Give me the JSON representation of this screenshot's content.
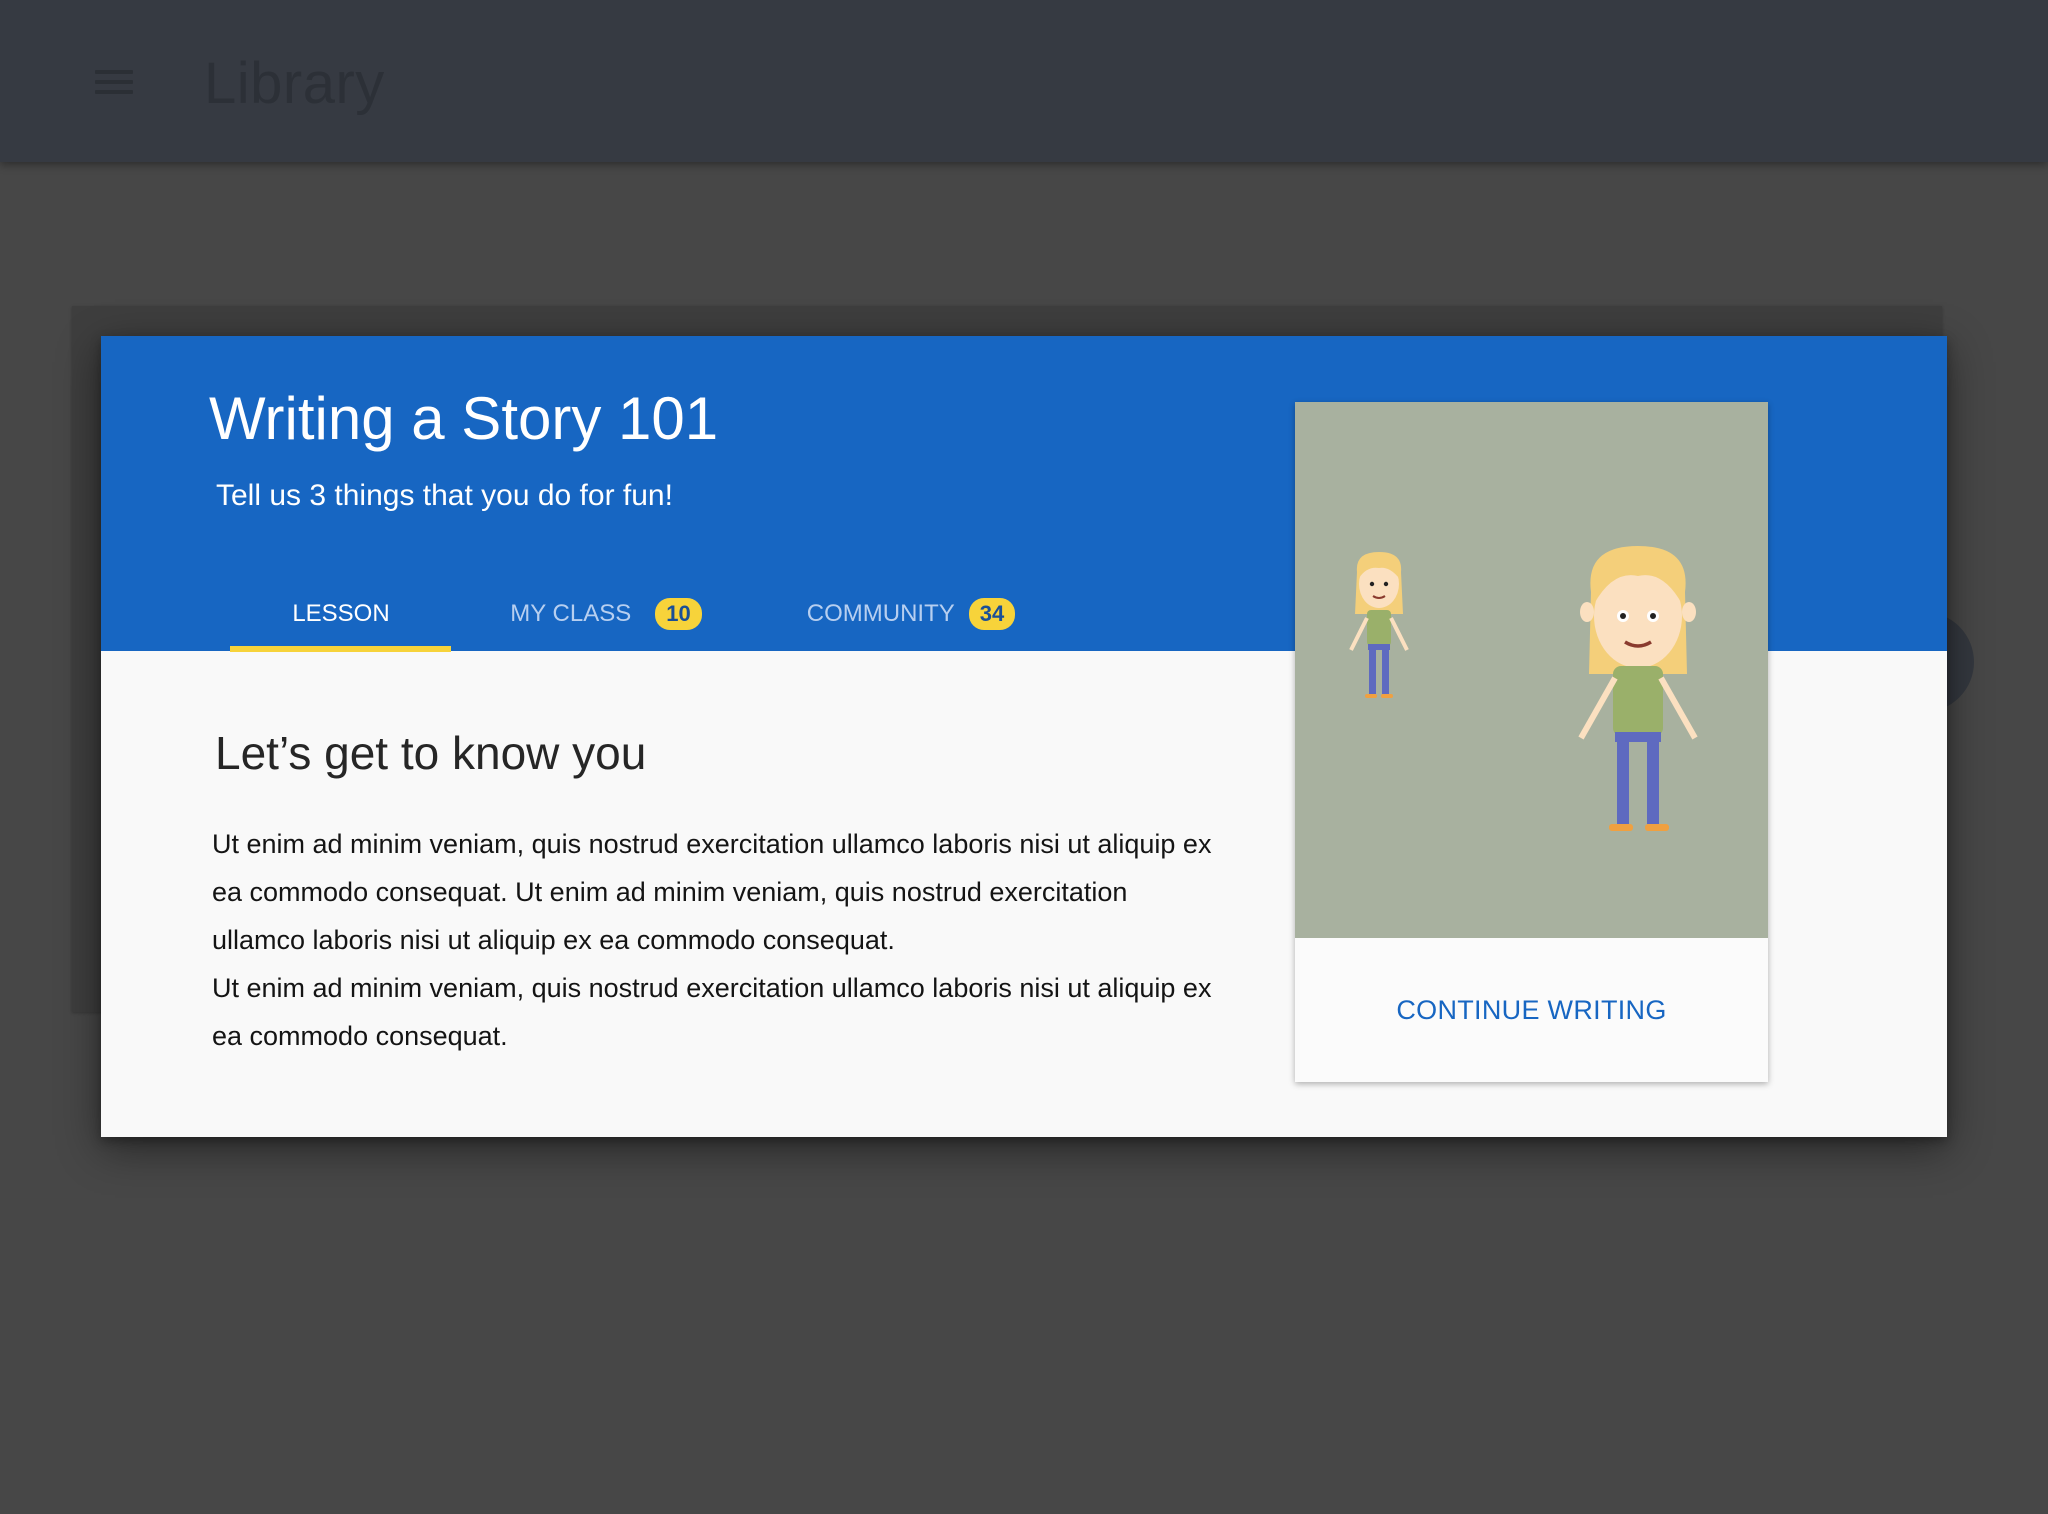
{
  "app": {
    "title": "Library"
  },
  "dialog": {
    "title": "Writing a Story 101",
    "subtitle": "Tell us 3 things that you do for fun!",
    "tabs": [
      {
        "label": "LESSON",
        "active": true
      },
      {
        "label": "MY CLASS",
        "badge": "10",
        "active": false
      },
      {
        "label": "COMMUNITY",
        "badge": "34",
        "active": false
      }
    ],
    "section_heading": "Let’s get to know you",
    "paragraphs": [
      "Ut enim ad minim veniam, quis nostrud exercitation ullamco laboris nisi ut aliquip ex ea commodo consequat.  Ut enim ad minim veniam, quis nostrud exercitation ullamco laboris nisi ut aliquip ex ea commodo consequat.",
      "Ut enim ad minim veniam, quis nostrud exercitation ullamco laboris nisi ut aliquip ex ea commodo consequat."
    ],
    "card": {
      "button_label": "CONTINUE WRITING"
    }
  },
  "icons": {
    "menu": "hamburger-menu-icon",
    "illustration": "cartoon-girl-illustration"
  },
  "colors": {
    "header_blue": "#1766c2",
    "accent_yellow": "#f7d33a",
    "app_bar": "#363a42",
    "scrim_background": "#474747",
    "card_image_bg": "#a8b19f",
    "button_text": "#1766c2"
  }
}
